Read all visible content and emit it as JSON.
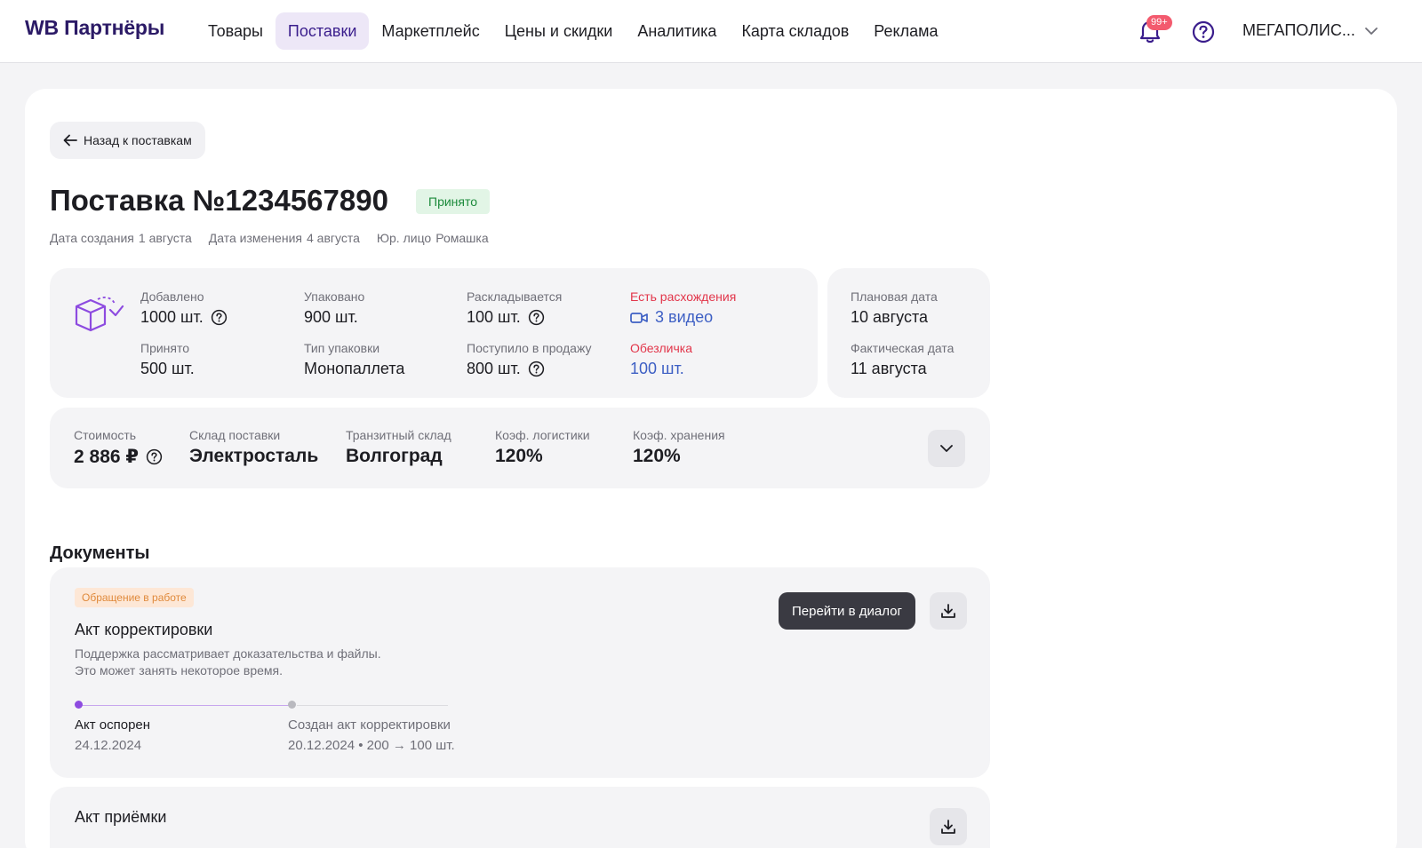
{
  "header": {
    "logo": "WB Партнёры",
    "nav": [
      {
        "label": "Товары",
        "active": false
      },
      {
        "label": "Поставки",
        "active": true
      },
      {
        "label": "Маркетплейс",
        "active": false
      },
      {
        "label": "Цены и скидки",
        "active": false
      },
      {
        "label": "Аналитика",
        "active": false
      },
      {
        "label": "Карта складов",
        "active": false
      },
      {
        "label": "Реклама",
        "active": false
      }
    ],
    "notifications_badge": "99+",
    "account_name": "МЕГАПОЛИС..."
  },
  "page": {
    "back_label": "Назад к поставкам",
    "title": "Поставка №1234567890",
    "status": "Принято",
    "meta": {
      "created_label": "Дата создания",
      "created_value": "1 августа",
      "modified_label": "Дата изменения",
      "modified_value": "4 августа",
      "entity_label": "Юр. лицо",
      "entity_value": "Ромашка"
    }
  },
  "stats": {
    "added_label": "Добавлено",
    "added_value": "1000 шт.",
    "packed_label": "Упаковано",
    "packed_value": "900 шт.",
    "sorting_label": "Раскладывается",
    "sorting_value": "100 шт.",
    "discrepancy_label": "Есть расхождения",
    "discrepancy_value": "3 видео",
    "accepted_label": "Принято",
    "accepted_value": "500 шт.",
    "pack_type_label": "Тип упаковки",
    "pack_type_value": "Монопаллета",
    "on_sale_label": "Поступило в продажу",
    "on_sale_value": "800 шт.",
    "depersonalized_label": "Обезличка",
    "depersonalized_value": "100 шт."
  },
  "dates": {
    "planned_label": "Плановая дата",
    "planned_value": "10 августа",
    "actual_label": "Фактическая дата",
    "actual_value": "11 августа"
  },
  "costs": {
    "cost_label": "Стоимость",
    "cost_value": "2 886 ₽",
    "warehouse_label": "Склад поставки",
    "warehouse_value": "Электросталь",
    "transit_label": "Транзитный склад",
    "transit_value": "Волгоград",
    "logistics_label": "Коэф. логистики",
    "logistics_value": "120%",
    "storage_label": "Коэф. хранения",
    "storage_value": "120%"
  },
  "documents": {
    "section_title": "Документы",
    "correction": {
      "tag": "Обращение в работе",
      "title": "Акт корректировки",
      "desc_line1": "Поддержка рассматривает доказательства и файлы.",
      "desc_line2": "Это может занять некоторое время.",
      "dialog_button": "Перейти в диалог",
      "timeline": [
        {
          "title": "Акт оспорен",
          "sub": "24.12.2024"
        },
        {
          "title": "Создан акт корректировки",
          "sub": "20.12.2024 • 200 → 100 шт."
        }
      ]
    },
    "acceptance": {
      "title": "Акт приёмки"
    }
  },
  "colors": {
    "brand": "#2b1a66",
    "accent": "#8d4be0",
    "alert": "#e2354a",
    "link": "#3d5fc4",
    "success": "#1c8a3b"
  },
  "icons": [
    "bell-icon",
    "help-icon",
    "chevron-down-icon",
    "arrow-left-icon",
    "box-icon",
    "question-icon",
    "video-icon",
    "download-icon"
  ]
}
